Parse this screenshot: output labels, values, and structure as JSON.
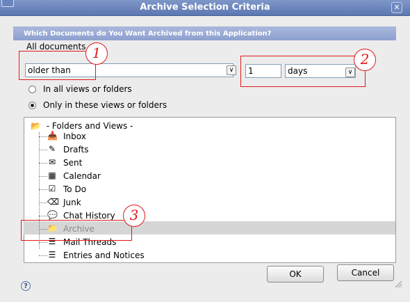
{
  "window": {
    "title": "Archive Selection Criteria",
    "close_icon": "close-icon"
  },
  "header": {
    "text": "Which Documents do You Want Archived from this Application?"
  },
  "criteria": {
    "label": "All documents",
    "condition_value": "older than",
    "number_value": "1",
    "unit_value": "days"
  },
  "options": {
    "all_views": "In all views or folders",
    "only_views": "Only in these views or folders",
    "selected": "only_views"
  },
  "tree": {
    "root": "- Folders and Views -",
    "items": [
      {
        "label": "Inbox",
        "icon": "inbox-icon"
      },
      {
        "label": "Drafts",
        "icon": "drafts-icon"
      },
      {
        "label": "Sent",
        "icon": "sent-icon"
      },
      {
        "label": "Calendar",
        "icon": "calendar-icon"
      },
      {
        "label": "To Do",
        "icon": "todo-icon"
      },
      {
        "label": "Junk",
        "icon": "junk-icon"
      },
      {
        "label": "Chat History",
        "icon": "chat-icon"
      },
      {
        "label": "Archive",
        "icon": "folder-icon",
        "selected": true
      },
      {
        "label": "Mail Threads",
        "icon": "threads-icon"
      },
      {
        "label": "Entries and Notices",
        "icon": "notices-icon"
      }
    ]
  },
  "buttons": {
    "ok": "OK",
    "cancel": "Cancel"
  },
  "annotations": {
    "one": "1",
    "two": "2",
    "three": "3",
    "color": "#e01818"
  },
  "colors": {
    "titlebar": "#5c77b1",
    "header_band": "#8da0cf",
    "selection": "#d6d6d6"
  }
}
